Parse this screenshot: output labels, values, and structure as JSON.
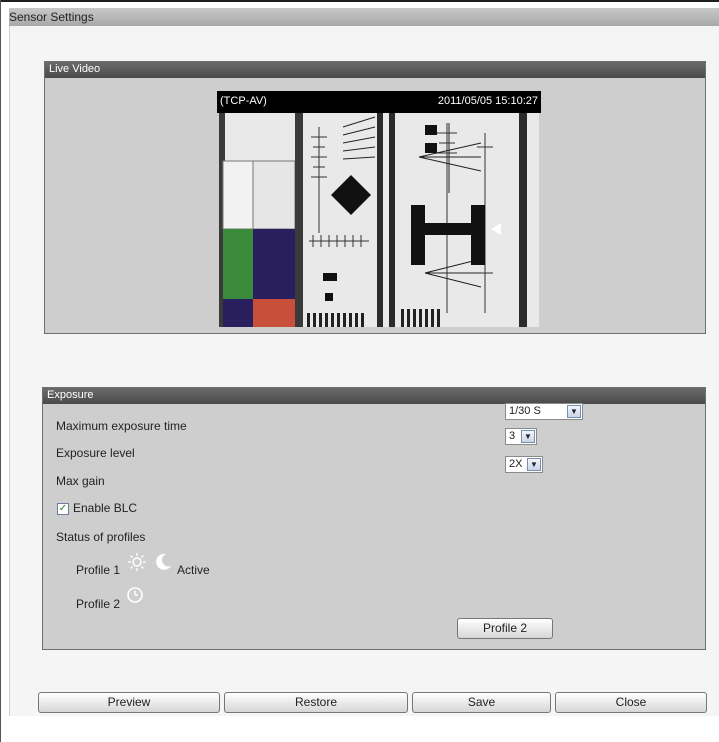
{
  "window": {
    "title": "Sensor Settings"
  },
  "live_video": {
    "header": "Live Video",
    "stream_label": "(TCP-AV)",
    "timestamp": "2011/05/05 15:10:27"
  },
  "exposure": {
    "header": "Exposure",
    "max_exposure": {
      "label": "Maximum exposure time",
      "value": "1/30 S"
    },
    "exposure_level": {
      "label": "Exposure level",
      "value": "3"
    },
    "max_gain": {
      "label": "Max gain",
      "value": "2X"
    },
    "blc": {
      "label": "Enable BLC",
      "checked": true
    },
    "status_label": "Status of profiles",
    "profiles": [
      {
        "label": "Profile 1",
        "icons": [
          "sun-icon",
          "moon-icon"
        ],
        "status": "Active"
      },
      {
        "label": "Profile 2",
        "icons": [
          "clock-icon"
        ],
        "status": ""
      }
    ],
    "profile_button": "Profile 2"
  },
  "buttons": {
    "preview": "Preview",
    "restore": "Restore",
    "save": "Save",
    "close": "Close"
  },
  "colors": {
    "panel_header": "#555555",
    "panel_body": "#cecece",
    "check_mark": "#2a7a2a"
  }
}
